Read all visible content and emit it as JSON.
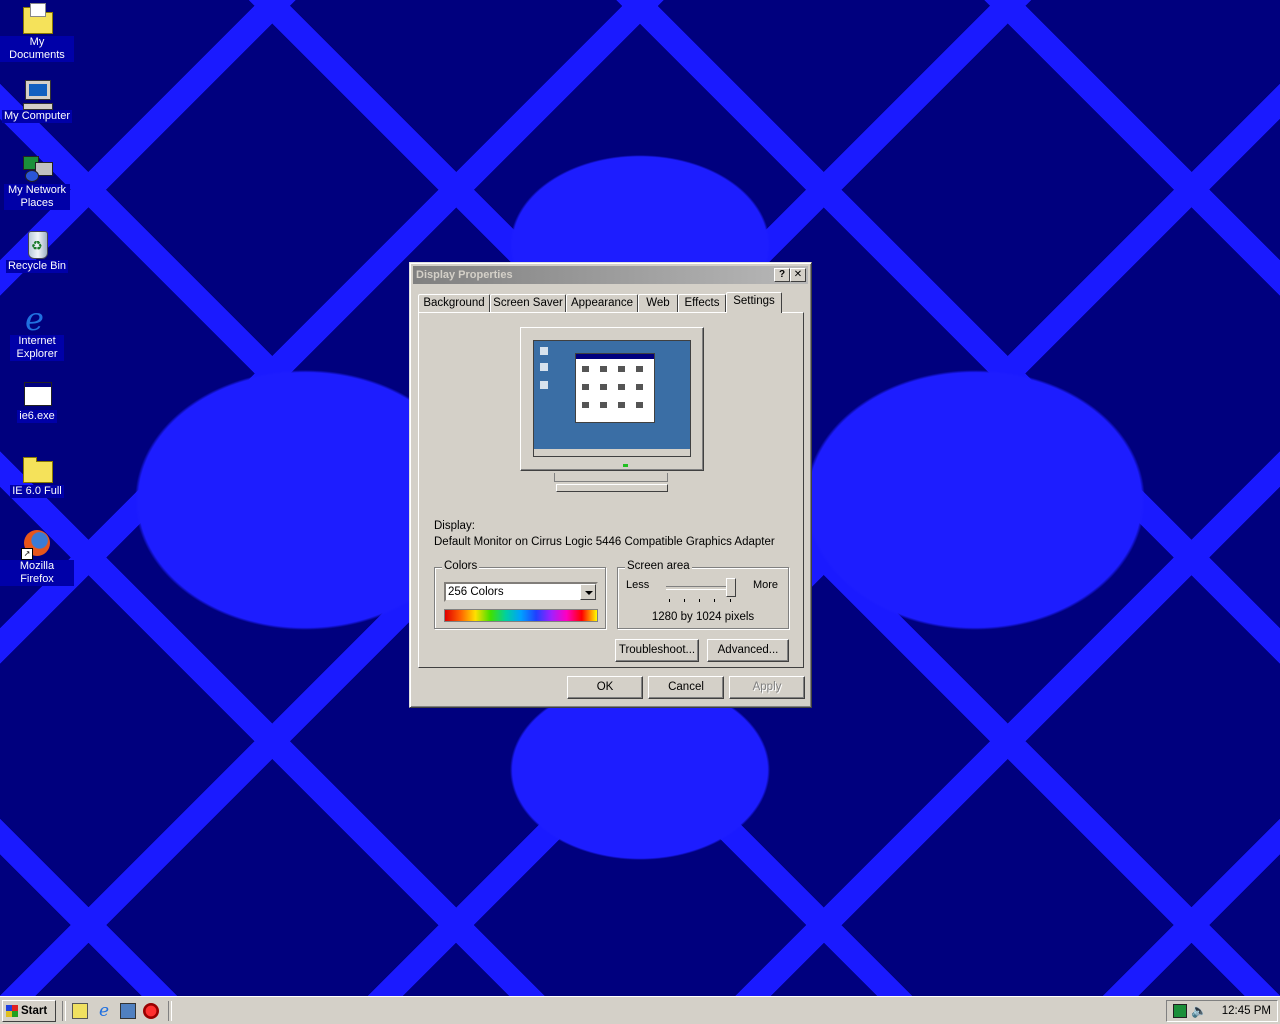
{
  "desktop": {
    "icons": [
      {
        "label": "My Documents"
      },
      {
        "label": "My Computer"
      },
      {
        "label": "My Network Places"
      },
      {
        "label": "Recycle Bin"
      },
      {
        "label": "Internet Explorer"
      },
      {
        "label": "ie6.exe"
      },
      {
        "label": "IE 6.0 Full"
      },
      {
        "label": "Mozilla Firefox"
      }
    ]
  },
  "dialog": {
    "title": "Display Properties",
    "help_glyph": "?",
    "close_glyph": "✕",
    "tabs": [
      "Background",
      "Screen Saver",
      "Appearance",
      "Web",
      "Effects",
      "Settings"
    ],
    "active_tab": "Settings",
    "display_label": "Display:",
    "display_value": "Default Monitor on Cirrus Logic 5446 Compatible Graphics Adapter",
    "colors": {
      "group_label": "Colors",
      "selected": "256 Colors"
    },
    "screen_area": {
      "group_label": "Screen area",
      "less_label": "Less",
      "more_label": "More",
      "resolution_text": "1280 by 1024 pixels"
    },
    "buttons": {
      "troubleshoot": "Troubleshoot...",
      "advanced": "Advanced...",
      "ok": "OK",
      "cancel": "Cancel",
      "apply": "Apply"
    }
  },
  "taskbar": {
    "start_label": "Start",
    "clock": "12:45 PM"
  },
  "colors": {
    "desktop_dark": "#00007e",
    "desktop_light": "#1d1dff",
    "face": "#d4d0c8",
    "inactive_title": "#808080"
  }
}
